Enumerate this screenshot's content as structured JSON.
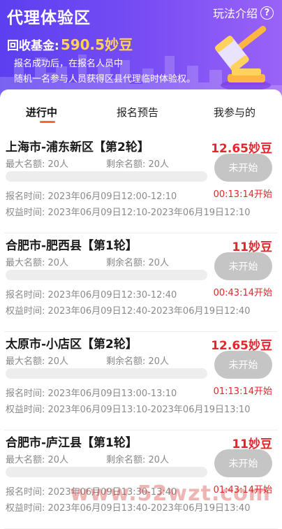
{
  "header": {
    "title": "代理体验区",
    "rules_label": "玩法介绍",
    "help_glyph": "?",
    "fund_label": "回收基金:",
    "fund_value": "590.5妙豆",
    "desc_line1": "报名成功后，在报名人员中",
    "desc_line2": "随机一名参与人员获得区县代理临时体验权。"
  },
  "tabs": [
    {
      "label": "进行中",
      "active": true
    },
    {
      "label": "报名预告",
      "active": false
    },
    {
      "label": "我参与的",
      "active": false
    }
  ],
  "colors": {
    "header_gradient_start": "#5c3ff0",
    "header_gradient_end": "#9a63f7",
    "fund_accent": "#ffd15a",
    "price_red": "#e3262b",
    "tab_underline": "#ff6a1a",
    "disabled_button": "#c5c5c5"
  },
  "icons": {
    "help": "question-circle-icon",
    "banner": "gavel-icon"
  },
  "items": [
    {
      "title": "上海市-浦东新区【第2轮】",
      "price": "12.65妙豆",
      "max_quota": "最大名额:  20人",
      "remaining_quota": "剩余名额:  20人",
      "progress": 0,
      "status": "未开始",
      "countdown": "00:13:14开始",
      "reg_time": "报名时间:  2023年06月09日12:00-12:10",
      "right_time": "权益时间:  2023年06月09日12:10-2023年06月19日12:10"
    },
    {
      "title": "合肥市-肥西县【第1轮】",
      "price": "11妙豆",
      "max_quota": "最大名额:  20人",
      "remaining_quota": "剩余名额:  20人",
      "progress": 0,
      "status": "未开始",
      "countdown": "00:43:14开始",
      "reg_time": "报名时间:  2023年06月09日12:30-12:40",
      "right_time": "权益时间:  2023年06月09日12:40-2023年06月19日12:40"
    },
    {
      "title": "太原市-小店区【第2轮】",
      "price": "12.65妙豆",
      "max_quota": "最大名额:  20人",
      "remaining_quota": "剩余名额:  20人",
      "progress": 0,
      "status": "未开始",
      "countdown": "01:13:14开始",
      "reg_time": "报名时间:  2023年06月09日13:00-13:10",
      "right_time": "权益时间:  2023年06月09日13:10-2023年06月19日13:10"
    },
    {
      "title": "合肥市-庐江县【第1轮】",
      "price": "11妙豆",
      "max_quota": "最大名额:  20人",
      "remaining_quota": "剩余名额:  20人",
      "progress": 0,
      "status": "未开始",
      "countdown": "01:43:14开始",
      "reg_time": "报名时间:  2023年06月09日13:30-13:40",
      "right_time": "权益时间:  2023年06月09日13:40-2023年06月19日13:40"
    }
  ],
  "watermark": "www.52wzt.com"
}
